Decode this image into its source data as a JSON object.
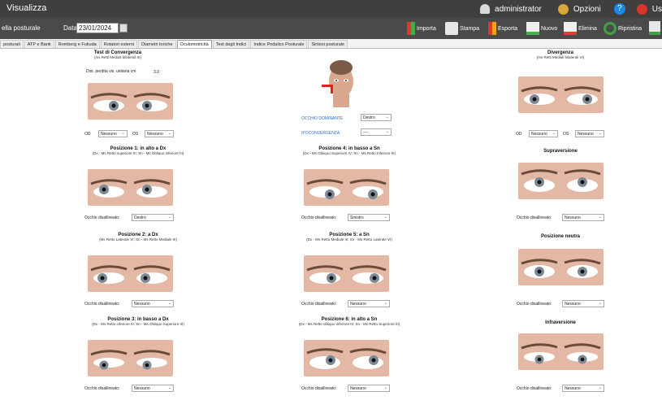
{
  "window": {
    "title": "Visualizza",
    "user": "administrator",
    "options": "Opzioni",
    "help": "?",
    "extra": "Us"
  },
  "toolbar": {
    "section": "ella posturale",
    "date_label": "Data",
    "date_value": "23/01/2024",
    "actions": [
      "Importa",
      "Stampa",
      "Esporta",
      "Nuovo",
      "Elimina",
      "Ripristina"
    ]
  },
  "tabs": [
    "posturali",
    "ATP e Bank",
    "Romberg e Fukuda",
    "Rotatori esterni",
    "Diametri toriche",
    "Oculomotricità",
    "Test degli Indici",
    "Indice Podalico Posturale",
    "Sintesi posturale"
  ],
  "active_tab": 5,
  "convergenza": {
    "title": "Test di Convergenza",
    "subtitle": "(ms Retti Mediali bilaterali III)",
    "dist_label": "Dist. perdita vis. unitaria cm",
    "dist_value": "3.0",
    "od_label": "OD",
    "od_value": "Nessuno",
    "os_label": "OS",
    "os_value": "Nessuno"
  },
  "divergenza": {
    "title": "Divergenza",
    "subtitle": "(ms Retti Mediali bilaterali VI)",
    "od_label": "OD",
    "od_value": "Nessuno",
    "os_label": "OS",
    "os_value": "Nessuno"
  },
  "center": {
    "occhio_label": "OCCHIO DOMINANTE",
    "occhio_value": "Destro",
    "ipo_label": "IPOCONVERGENZA",
    "ipo_value": "----"
  },
  "positions": [
    {
      "title": "Posizione 1: in alto a Dx",
      "subtitle": "(Dx - Ms Retto superiore III; Sn - Ms Obliquo inferiore III)",
      "label": "Occhio disallineato:",
      "value": "Destro"
    },
    {
      "title": "Posizione 4: in basso a Sn",
      "subtitle": "(Dx - Ms Obliquo Superiore IV; Sn - Ms Retto Inferiore III)",
      "label": "Occhio disallineato:",
      "value": "Sinistro"
    },
    {
      "title": "Supraversione",
      "subtitle": "",
      "label": "Occhio disallineato:",
      "value": "Nessuno"
    },
    {
      "title": "Posizione 2: a Dx",
      "subtitle": "(Ms Retto Laterale VI; Sn - Ms Retto Mediale III)",
      "label": "Occhio disallineato:",
      "value": "Nessuno"
    },
    {
      "title": "Posizione 5: a Sn",
      "subtitle": "(Dx - Ms Retto Mediale III; Sn - Ms Retto Laterale VI)",
      "label": "Occhio disallineato:",
      "value": "Nessuno"
    },
    {
      "title": "Posizione neutra",
      "subtitle": "",
      "label": "Occhio disallineato:",
      "value": "Nessuno"
    },
    {
      "title": "Posizione 3: in basso a Dx",
      "subtitle": "(Dx - Ms Retto inferiore III; Sn - Ms Obliquo Superiore III)",
      "label": "Occhio disallineato:",
      "value": "Nessuno"
    },
    {
      "title": "Posizione 6: in alto a Sn",
      "subtitle": "(Dx - Ms Retto obliquo inferiore III; Sn - Ms Retto Superiore III)",
      "label": "Occhio disallineato:",
      "value": "Nessuno"
    },
    {
      "title": "Infraversione",
      "subtitle": "",
      "label": "Occhio disallineato:",
      "value": "Nessuno"
    }
  ],
  "colors": {
    "titlebar": "#3f3f3f",
    "toolbar": "#4a4a4a",
    "accent_blue": "#2f6fd0",
    "skin": "#e3b9a6"
  }
}
